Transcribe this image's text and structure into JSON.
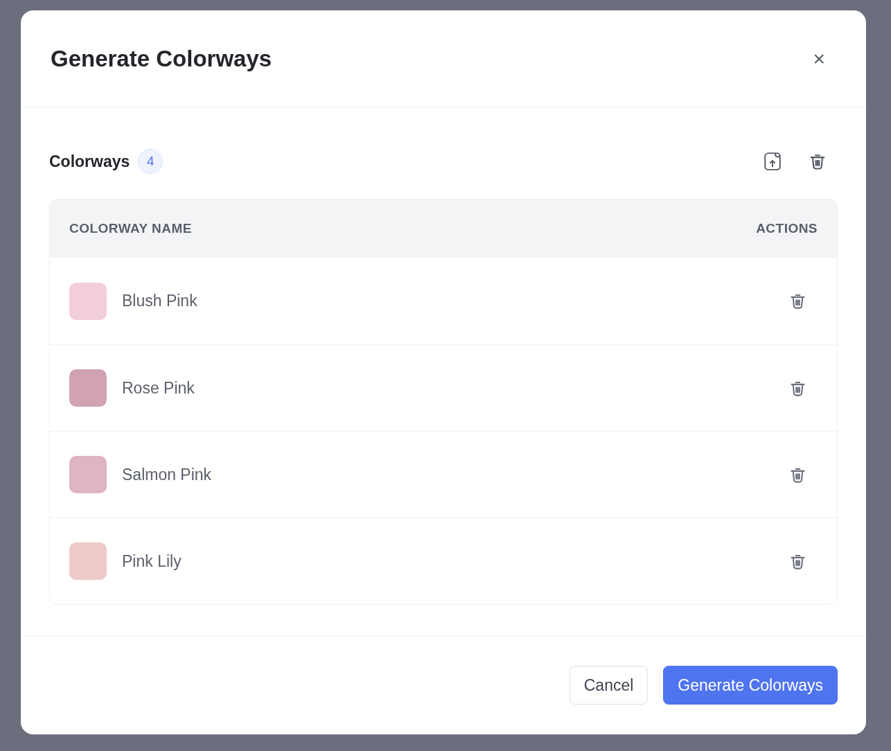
{
  "dialog": {
    "title": "Generate Colorways",
    "close": "×"
  },
  "section": {
    "label": "Colorways",
    "count": "4"
  },
  "table": {
    "columns": [
      "COLORWAY NAME",
      "ACTIONS"
    ],
    "rows": [
      {
        "name": "Blush Pink",
        "color": "#f2cfd9"
      },
      {
        "name": "Rose Pink",
        "color": "#d1a2b0"
      },
      {
        "name": "Salmon Pink",
        "color": "#e0b5c3"
      },
      {
        "name": "Pink Lily",
        "color": "#edc9c7"
      }
    ]
  },
  "buttons": [
    {
      "label": "Cancel",
      "kind": "secondary"
    },
    {
      "label": "Generate Colorways",
      "kind": "primary"
    }
  ]
}
